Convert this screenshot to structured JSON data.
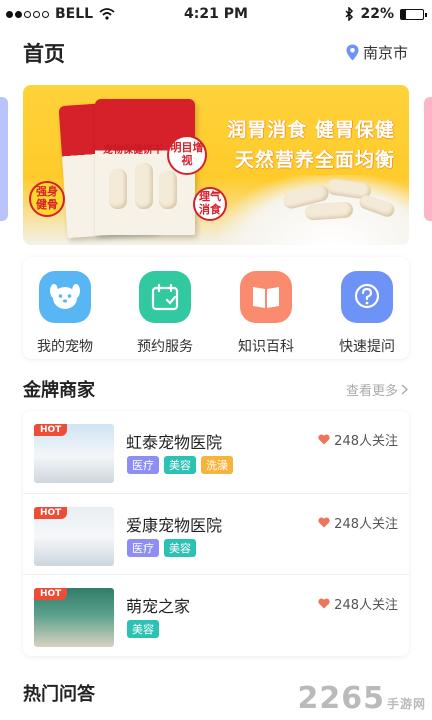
{
  "status_bar": {
    "carrier": "BELL",
    "time": "4:21 PM",
    "battery_percent": "22%",
    "battery_level": 0.22,
    "icons": [
      "signal-dots-icon",
      "wifi-icon",
      "bluetooth-icon",
      "battery-icon"
    ]
  },
  "header": {
    "title": "首页",
    "location": "南京市",
    "location_icon": "location-pin-icon"
  },
  "banner": {
    "headline": "润胃消食 健胃保健",
    "subline": "天然营养全面均衡",
    "package_text": "宠物保健饼干",
    "stickers": [
      "强身健骨",
      "明目增视",
      "理气消食"
    ],
    "colors": {
      "background": "#ffcb2b",
      "bag": "#d6202a"
    }
  },
  "quick_actions": [
    {
      "label": "我的宠物",
      "icon": "pet-face-icon",
      "color": "#58b6f5"
    },
    {
      "label": "预约服务",
      "icon": "calendar-icon",
      "color": "#33c9a0"
    },
    {
      "label": "知识百科",
      "icon": "book-icon",
      "color": "#fb8b6e"
    },
    {
      "label": "快速提问",
      "icon": "question-bubble-icon",
      "color": "#6e93f6"
    }
  ],
  "merchants_section": {
    "title": "金牌商家",
    "see_more": "查看更多",
    "items": [
      {
        "badge": "HOT",
        "name": "虹泰宠物医院",
        "followers": "248人关注",
        "tags": [
          "医疗",
          "美容",
          "洗澡"
        ]
      },
      {
        "badge": "HOT",
        "name": "爱康宠物医院",
        "followers": "248人关注",
        "tags": [
          "医疗",
          "美容"
        ]
      },
      {
        "badge": "HOT",
        "name": "萌宠之家",
        "followers": "248人关注",
        "tags": [
          "美容"
        ]
      }
    ],
    "tag_colors": {
      "医疗": "#8c8ef4",
      "美容": "#2cc2b3",
      "洗澡": "#f6b43c"
    },
    "heart_color": "#f0735b"
  },
  "qa_section": {
    "title": "热门问答"
  },
  "watermark": {
    "text": "2265",
    "suffix": "手游网"
  }
}
